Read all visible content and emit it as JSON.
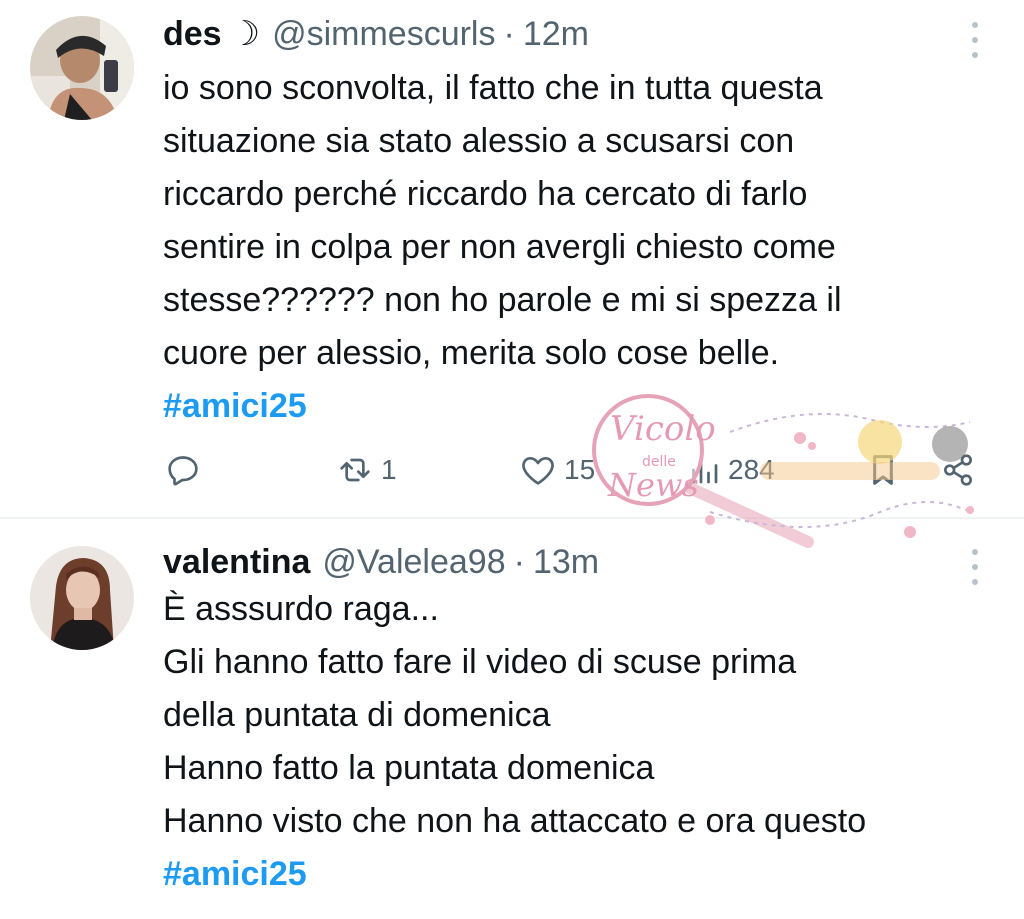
{
  "tweets": [
    {
      "name": "des",
      "name_symbol": "☽",
      "handle": "@simmescurls",
      "separator": "·",
      "time": "12m",
      "lines": [
        "io sono sconvolta, il fatto che in tutta questa",
        "situazione sia stato alessio a scusarsi con",
        "riccardo perché riccardo ha cercato di farlo",
        "sentire in colpa per non avergli chiesto come",
        "stesse?????? non ho parole e mi si spezza il",
        "cuore per alessio, merita solo cose belle."
      ],
      "hashtag": "#amici25",
      "stats": {
        "reply_icon": "reply-icon",
        "retweets": "1",
        "likes": "15",
        "views": "284"
      }
    },
    {
      "name": "valentina",
      "handle": "@Valelea98",
      "separator": "·",
      "time": "13m",
      "lines": [
        "È asssurdo raga...",
        "Gli hanno fatto fare il video di scuse prima",
        "della puntata di domenica",
        "Hanno fatto la puntata domenica",
        "Hanno visto che non ha attaccato e ora questo"
      ],
      "hashtag": "#amici25"
    }
  ],
  "watermark": {
    "text_main": "Vicolo",
    "text_small": "delle",
    "text_bottom": "News"
  },
  "colors": {
    "text": "#0f1419",
    "secondary": "#536471",
    "hashtag": "#1d9bf0",
    "divider": "#eff3f4",
    "watermark": "#e6a3b8"
  }
}
